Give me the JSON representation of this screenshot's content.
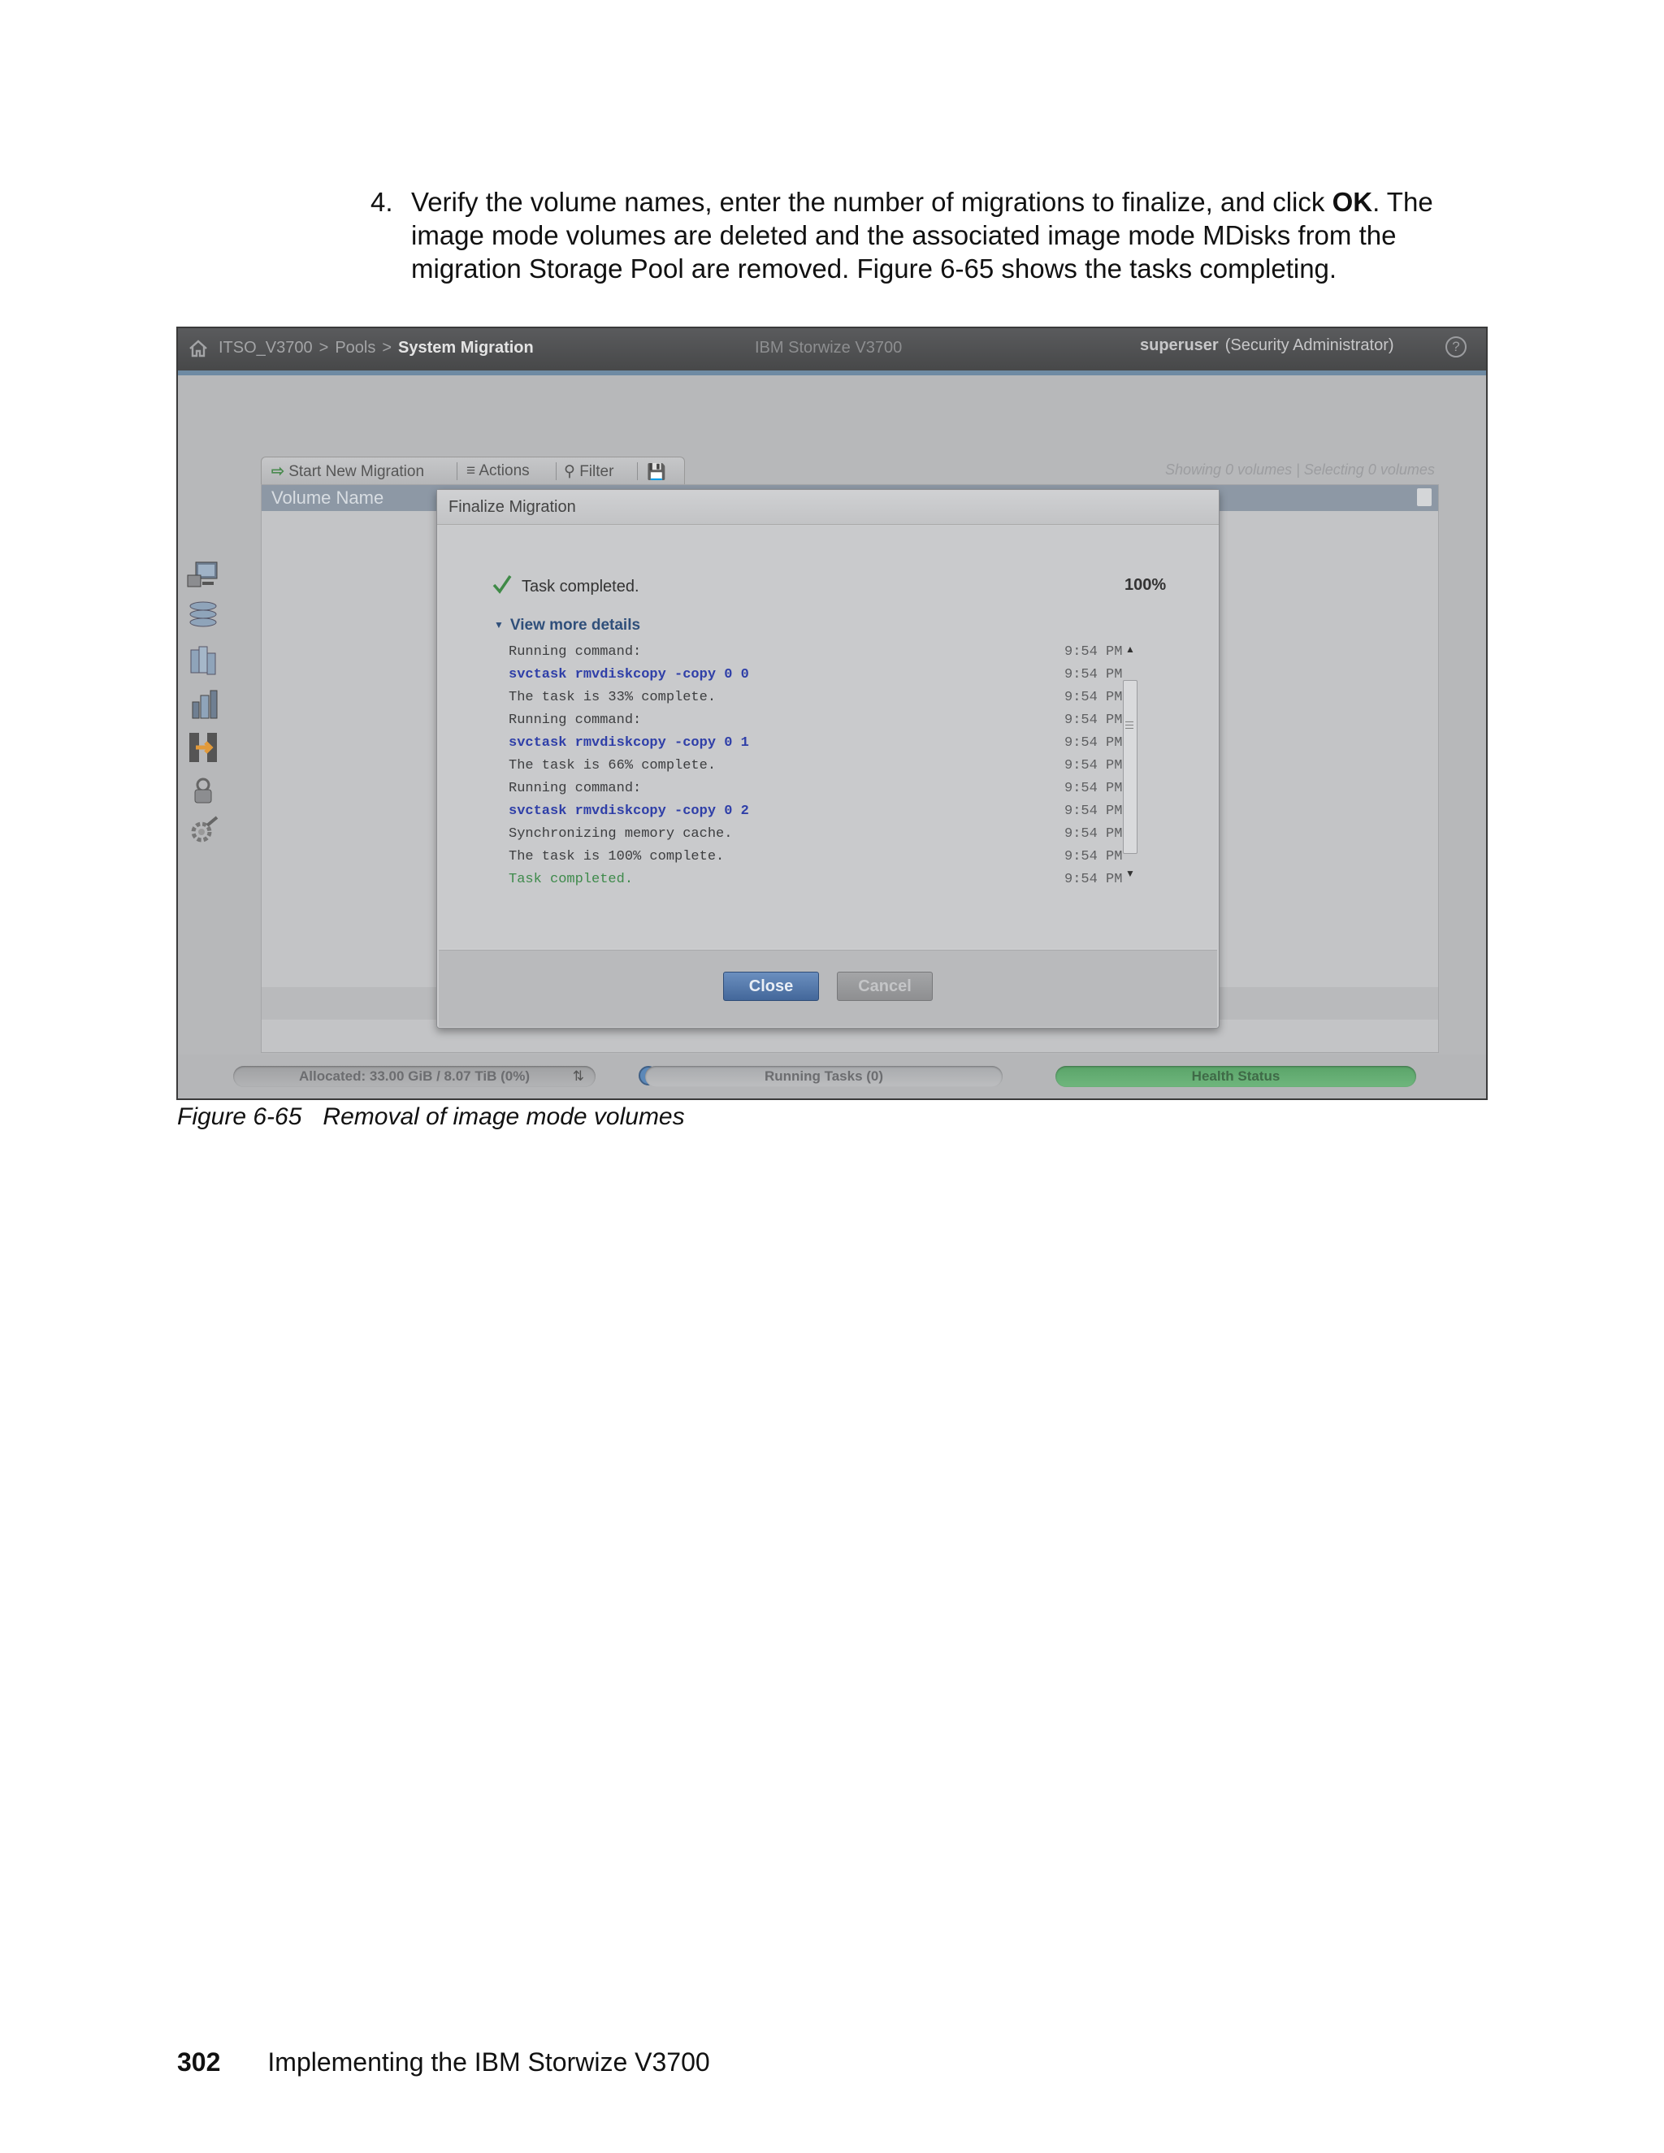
{
  "document": {
    "step_number": "4.",
    "step_text_before": "Verify the volume names, enter the number of migrations to finalize, and click ",
    "step_bold": "OK",
    "step_text_after": ". The image mode volumes are deleted and the associated image mode MDisks from the migration Storage Pool are removed. Figure 6-65 shows the tasks completing.",
    "caption_label": "Figure 6-65",
    "caption_text": "Removal of image mode volumes",
    "page_number": "302",
    "footer_title": "Implementing the IBM Storwize V3700"
  },
  "app": {
    "breadcrumb": [
      "ITSO_V3700",
      "Pools",
      "System Migration"
    ],
    "breadcrumb_sep": ">",
    "product": "IBM Storwize V3700",
    "user": "superuser",
    "role": "(Security Administrator)",
    "help": "?"
  },
  "toolbar": {
    "start_new_migration": "Start New Migration",
    "actions": "Actions",
    "filter": "Filter",
    "showing": "Showing 0 volumes | Selecting 0 volumes"
  },
  "grid": {
    "column_volume_name": "Volume Name"
  },
  "dialog": {
    "title": "Finalize Migration",
    "status": "Task completed.",
    "progress_text": "100%",
    "progress": 1.0,
    "details_toggle": "View more details",
    "log": [
      {
        "msg": "Running command:",
        "time": "9:54 PM",
        "kind": "info"
      },
      {
        "msg": "svctask rmvdiskcopy -copy 0 0",
        "time": "9:54 PM",
        "kind": "cmd"
      },
      {
        "msg": "The task is 33% complete.",
        "time": "9:54 PM",
        "kind": "info"
      },
      {
        "msg": "Running command:",
        "time": "9:54 PM",
        "kind": "info"
      },
      {
        "msg": "svctask rmvdiskcopy -copy 0 1",
        "time": "9:54 PM",
        "kind": "cmd"
      },
      {
        "msg": "The task is 66% complete.",
        "time": "9:54 PM",
        "kind": "info"
      },
      {
        "msg": "Running command:",
        "time": "9:54 PM",
        "kind": "info"
      },
      {
        "msg": "svctask rmvdiskcopy -copy 0 2",
        "time": "9:54 PM",
        "kind": "cmd"
      },
      {
        "msg": "Synchronizing memory cache.",
        "time": "9:54 PM",
        "kind": "info"
      },
      {
        "msg": "The task is 100% complete.",
        "time": "9:54 PM",
        "kind": "info"
      },
      {
        "msg": "Task completed.",
        "time": "9:54 PM",
        "kind": "done"
      }
    ],
    "close_label": "Close",
    "cancel_label": "Cancel"
  },
  "statusbar": {
    "allocated": "Allocated: 33.00 GiB / 8.07 TiB (0%)",
    "running_tasks": "Running Tasks (0)",
    "health_status": "Health Status"
  },
  "colors": {
    "accent_blue": "#43679a",
    "command_text": "#2f3fa8",
    "success_green": "#3e8a4b",
    "health_green": "#5aa469"
  },
  "icons": {
    "side": [
      "monitoring-icon",
      "pools-icon",
      "volumes-icon",
      "hosts-icon",
      "copy-services-icon",
      "access-icon",
      "settings-icon"
    ]
  }
}
